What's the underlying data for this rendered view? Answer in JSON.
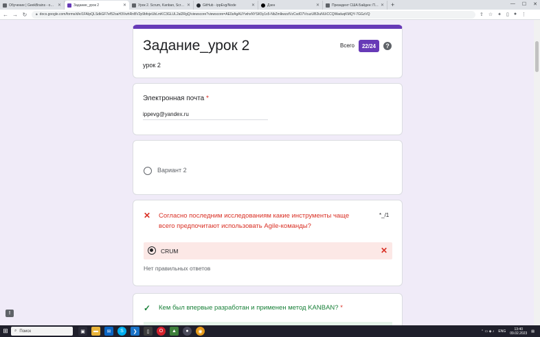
{
  "browser": {
    "tabs": [
      {
        "title": "Обучение | GeekBrains - образо",
        "favicon_color": "#5f6368",
        "active": false
      },
      {
        "title": "Задание_урок 2",
        "favicon_color": "#673ab7",
        "active": true
      },
      {
        "title": "Урок 2. Scrum, Kanban, Scrumb",
        "favicon_color": "#5f6368",
        "active": false
      },
      {
        "title": "GitHub - ippEvg/Node",
        "favicon_color": "#24292e",
        "active": false
      },
      {
        "title": "Дзен",
        "favicon_color": "#000000",
        "active": false
      },
      {
        "title": "Президент США Байден: Путин",
        "favicon_color": "#5f6368",
        "active": false
      }
    ],
    "url": "docs.google.com/forms/d/e/1FAIpQLSdkGF7ef52oaH3VwhRnBV2p9bfojeUbLmKC3GLUL2al2RgQ/viewscore?viewscore=AE0zAgAUYwhxNYSK5y1x5-NbZmlkwzzlVzCsdO7VcuzUB2iuNUiCCQWaduqKMQY-7GGzVQ"
  },
  "form": {
    "title": "Задание_урок 2",
    "subtitle": "урок 2",
    "total_label": "Всего",
    "score": "22/24"
  },
  "email_question": {
    "label": "Электронная почта",
    "required_mark": "*",
    "value": "ippevg@yandex.ru"
  },
  "variant_question": {
    "option_label": "Вариант 2"
  },
  "question_1": {
    "text": "Согласно последним исследованиям какие инструменты чаще всего предпочитают использовать Agile-команды?",
    "points": "*_/1",
    "answer": "CRUM",
    "no_correct_text": "Нет правильных ответов",
    "status_color": "#d93025"
  },
  "question_2": {
    "text": "Кем был впервые разработан и применен метод  KANBAN?",
    "required_mark": "*",
    "status_color": "#188038"
  },
  "taskbar": {
    "search_placeholder": "Поиск",
    "language": "ENG",
    "time": "13:40",
    "date": "09.02.2023"
  },
  "colors": {
    "accent": "#673ab7",
    "background": "#f0ebf8",
    "error": "#d93025",
    "success": "#188038"
  },
  "icons": [
    "back-arrow-icon",
    "forward-arrow-icon",
    "reload-icon",
    "lock-icon",
    "help-icon",
    "wrong-answer-icon",
    "correct-answer-icon",
    "feedback-icon",
    "windows-start-icon",
    "search-icon"
  ]
}
